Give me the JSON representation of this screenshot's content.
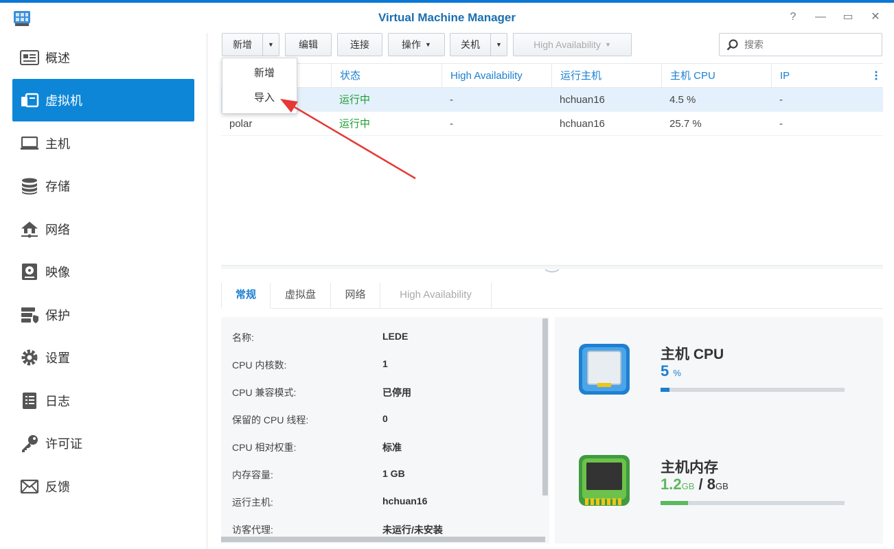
{
  "window": {
    "title": "Virtual Machine Manager",
    "help": "?",
    "minimize": "—",
    "maximize": "▭",
    "close": "✕"
  },
  "sidebar": {
    "items": [
      {
        "label": "概述",
        "icon": "overview-icon",
        "active": false
      },
      {
        "label": "虚拟机",
        "icon": "vm-icon",
        "active": true
      },
      {
        "label": "主机",
        "icon": "host-icon",
        "active": false
      },
      {
        "label": "存储",
        "icon": "storage-icon",
        "active": false
      },
      {
        "label": "网络",
        "icon": "network-icon",
        "active": false
      },
      {
        "label": "映像",
        "icon": "image-icon",
        "active": false
      },
      {
        "label": "保护",
        "icon": "protection-icon",
        "active": false
      },
      {
        "label": "设置",
        "icon": "settings-icon",
        "active": false
      },
      {
        "label": "日志",
        "icon": "log-icon",
        "active": false
      },
      {
        "label": "许可证",
        "icon": "license-icon",
        "active": false
      },
      {
        "label": "反馈",
        "icon": "feedback-icon",
        "active": false
      }
    ]
  },
  "toolbar": {
    "new_label": "新增",
    "edit_label": "编辑",
    "connect_label": "连接",
    "action_label": "操作",
    "shutdown_label": "关机",
    "ha_label": "High Availability",
    "search_placeholder": "搜索"
  },
  "new_menu": {
    "items": [
      "新增",
      "导入"
    ]
  },
  "table": {
    "columns": [
      "状态",
      "High Availability",
      "运行主机",
      "主机 CPU",
      "IP"
    ],
    "rows": [
      {
        "name": "",
        "status": "运行中",
        "ha": "-",
        "host": "hchuan16",
        "cpu": "4.5 %",
        "ip": "-",
        "selected": true
      },
      {
        "name": "polar",
        "status": "运行中",
        "ha": "-",
        "host": "hchuan16",
        "cpu": "25.7 %",
        "ip": "-",
        "selected": false
      }
    ]
  },
  "tabs": [
    {
      "label": "常规",
      "active": true,
      "disabled": false
    },
    {
      "label": "虚拟盘",
      "active": false,
      "disabled": false
    },
    {
      "label": "网络",
      "active": false,
      "disabled": false
    },
    {
      "label": "High Availability",
      "active": false,
      "disabled": true
    }
  ],
  "details": [
    {
      "label": "名称:",
      "value": "LEDE"
    },
    {
      "label": "CPU 内核数:",
      "value": "1"
    },
    {
      "label": "CPU 兼容模式:",
      "value": "已停用"
    },
    {
      "label": "保留的 CPU 线程:",
      "value": "0"
    },
    {
      "label": "CPU 相对权重:",
      "value": "标准"
    },
    {
      "label": "内存容量:",
      "value": "1 GB"
    },
    {
      "label": "运行主机:",
      "value": "hchuan16"
    },
    {
      "label": "访客代理:",
      "value": "未运行/未安装"
    }
  ],
  "resources": {
    "cpu": {
      "title": "主机 CPU",
      "value": "5",
      "unit": "%",
      "usage_fraction": 0.05,
      "color": "#1a7fd0"
    },
    "memory": {
      "title": "主机内存",
      "used": "1.2",
      "used_unit": "GB",
      "separator": "/",
      "total": "8",
      "total_unit": "GB",
      "usage_fraction": 0.15,
      "color": "#5cb85c"
    }
  },
  "colors": {
    "accent": "#0e86d8",
    "running": "#1e9e32",
    "annotation_arrow": "#e53935"
  }
}
